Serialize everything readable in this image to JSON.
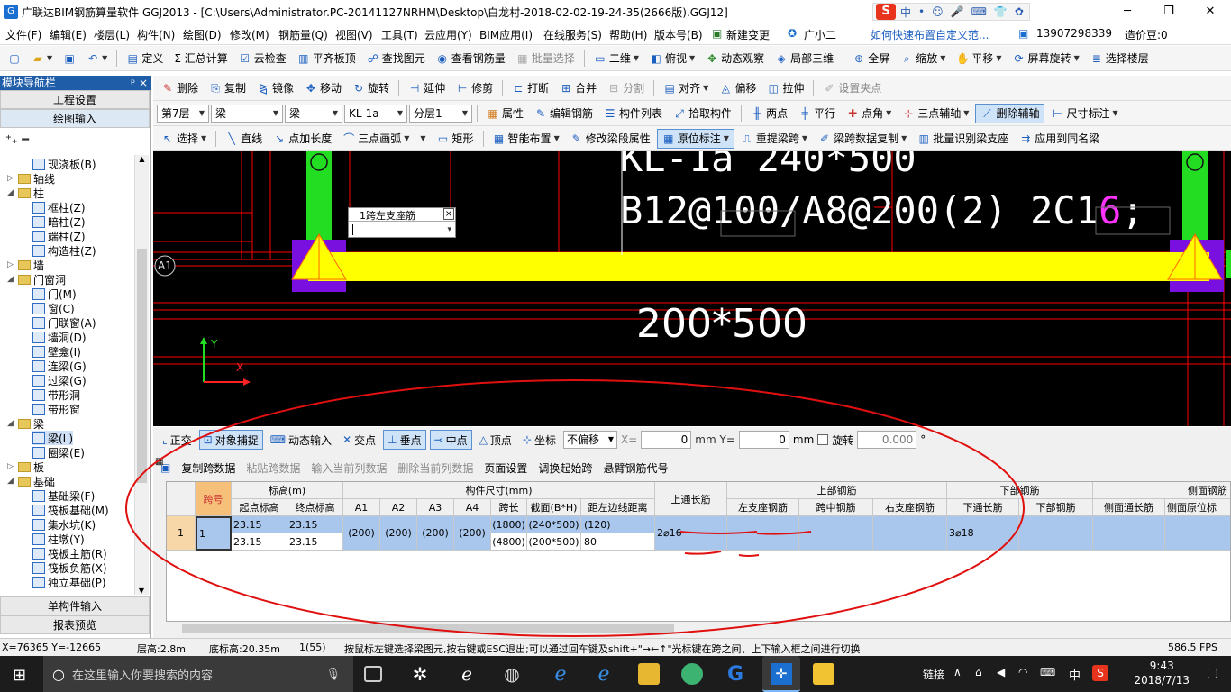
{
  "titlebar": {
    "title": "广联达BIM钢筋算量软件 GGJ2013 - [C:\\Users\\Administrator.PC-20141127NRHM\\Desktop\\白龙村-2018-02-02-19-24-35(2666版).GGJ12]",
    "ime_items": [
      "中",
      "•",
      "☺",
      "🎤",
      "⌨",
      "👕",
      "✿"
    ]
  },
  "menubar": {
    "items": [
      "文件(F)",
      "编辑(E)",
      "楼层(L)",
      "构件(N)",
      "绘图(D)",
      "修改(M)",
      "钢筋量(Q)",
      "视图(V)",
      "工具(T)",
      "云应用(Y)",
      "BIM应用(I)",
      "在线服务(S)",
      "帮助(H)",
      "版本号(B)",
      "新建变更",
      "广小二"
    ],
    "help_link": "如何快速布置自定义范...",
    "phone": "13907298339",
    "price": "造价豆:0"
  },
  "toolbar1": [
    "定义",
    "Σ 汇总计算",
    "云检查",
    "平齐板顶",
    "查找图元",
    "查看钢筋量",
    "批量选择",
    "二维",
    "俯视",
    "动态观察",
    "局部三维",
    "全屏",
    "缩放",
    "平移",
    "屏幕旋转",
    "选择楼层"
  ],
  "toolbar2": [
    "删除",
    "复制",
    "镜像",
    "移动",
    "旋转",
    "延伸",
    "修剪",
    "打断",
    "合并",
    "分割",
    "对齐",
    "偏移",
    "拉伸",
    "设置夹点"
  ],
  "toolbar3": {
    "floor": "第7层",
    "cat1": "梁",
    "cat2": "梁",
    "member": "KL-1a",
    "layer": "分层1",
    "buttons": [
      "属性",
      "编辑钢筋",
      "构件列表",
      "拾取构件",
      "两点",
      "平行",
      "点角",
      "三点辅轴",
      "删除辅轴",
      "尺寸标注"
    ]
  },
  "toolbar4": [
    "选择",
    "直线",
    "点加长度",
    "三点画弧",
    "矩形",
    "智能布置",
    "修改梁段属性",
    "原位标注",
    "重提梁跨",
    "梁跨数据复制",
    "批量识别梁支座",
    "应用到同名梁"
  ],
  "leftpanel": {
    "header": "模块导航栏",
    "pin": "ᵖ ×",
    "btn_project": "工程设置",
    "btn_draw": "绘图输入",
    "btn_single": "单构件输入",
    "btn_report": "报表预览",
    "tree": [
      {
        "label": "现浇板(B)",
        "level": 2
      },
      {
        "label": "轴线",
        "level": 0,
        "folder": true,
        "toggle": "+"
      },
      {
        "label": "柱",
        "level": 0,
        "folder": true,
        "toggle": "−"
      },
      {
        "label": "框柱(Z)",
        "level": 2
      },
      {
        "label": "暗柱(Z)",
        "level": 2
      },
      {
        "label": "端柱(Z)",
        "level": 2
      },
      {
        "label": "构造柱(Z)",
        "level": 2
      },
      {
        "label": "墙",
        "level": 0,
        "folder": true,
        "toggle": "+"
      },
      {
        "label": "门窗洞",
        "level": 0,
        "folder": true,
        "toggle": "−"
      },
      {
        "label": "门(M)",
        "level": 2
      },
      {
        "label": "窗(C)",
        "level": 2
      },
      {
        "label": "门联窗(A)",
        "level": 2
      },
      {
        "label": "墙洞(D)",
        "level": 2
      },
      {
        "label": "壁龛(I)",
        "level": 2
      },
      {
        "label": "连梁(G)",
        "level": 2
      },
      {
        "label": "过梁(G)",
        "level": 2
      },
      {
        "label": "带形洞",
        "level": 2
      },
      {
        "label": "带形窗",
        "level": 2
      },
      {
        "label": "梁",
        "level": 0,
        "folder": true,
        "toggle": "−"
      },
      {
        "label": "梁(L)",
        "level": 2,
        "selected": true
      },
      {
        "label": "圈梁(E)",
        "level": 2
      },
      {
        "label": "板",
        "level": 0,
        "folder": true,
        "toggle": "+"
      },
      {
        "label": "基础",
        "level": 0,
        "folder": true,
        "toggle": "−"
      },
      {
        "label": "基础梁(F)",
        "level": 2
      },
      {
        "label": "筏板基础(M)",
        "level": 2
      },
      {
        "label": "集水坑(K)",
        "level": 2
      },
      {
        "label": "柱墩(Y)",
        "level": 2
      },
      {
        "label": "筏板主筋(R)",
        "level": 2
      },
      {
        "label": "筏板负筋(X)",
        "level": 2
      },
      {
        "label": "独立基础(P)",
        "level": 2
      }
    ]
  },
  "canvas": {
    "annot_line1": "KL-1a 240*500",
    "annot_line2_a": "B12@100/A8@200(2) 2C1",
    "annot_line2_b": "6",
    "annot_line2_c": ";",
    "section_label": "200*500",
    "axis_label": "A1",
    "axis_y": "Y",
    "axis_x": "X",
    "popup_title": "1跨左支座筋",
    "popup_close": "×"
  },
  "snapbar": {
    "items": [
      "正交",
      "对象捕捉",
      "动态输入",
      "交点",
      "垂点",
      "中点",
      "顶点",
      "坐标"
    ],
    "offset": "不偏移",
    "x_label": "X=",
    "x_value": "0",
    "y_label": "mm Y=",
    "y_value": "0",
    "mm": "mm",
    "rotate": "旋转",
    "rotate_value": "0.000",
    "deg": "°"
  },
  "gridtoolbar": {
    "items": [
      "复制跨数据",
      "粘贴跨数据",
      "输入当前列数据",
      "删除当前列数据",
      "页面设置",
      "调换起始跨",
      "悬臂钢筋代号"
    ]
  },
  "grid": {
    "group_headers": [
      "跨号",
      "标高(m)",
      "构件尺寸(mm)",
      "上通长筋",
      "上部钢筋",
      "下部钢筋",
      "侧面钢筋"
    ],
    "sub_headers": [
      "起点标高",
      "终点标高",
      "A1",
      "A2",
      "A3",
      "A4",
      "跨长",
      "截面(B*H)",
      "距左边线距离",
      "左支座钢筋",
      "跨中钢筋",
      "右支座钢筋",
      "下通长筋",
      "下部钢筋",
      "侧面通长筋",
      "侧面原位标"
    ],
    "row": {
      "num": "1",
      "span": "1",
      "start_el_1": "23.15",
      "end_el_1": "23.15",
      "start_el_2": "23.15",
      "end_el_2": "23.15",
      "a1": "(200)",
      "a2": "(200)",
      "a3": "(200)",
      "a4": "(200)",
      "len1": "(1800)",
      "len2": "(4800)",
      "sec1": "(240*500)",
      "sec2": "(200*500)",
      "dist1": "(120)",
      "dist2": "80",
      "top_cont": "2⌀16",
      "bot_cont": "3⌀18"
    }
  },
  "statusbar": {
    "coords": "X=76365 Y=-12665",
    "floor_h": "层高:2.8m",
    "base_el": "底标高:20.35m",
    "count": "1(55)",
    "hint": "按鼠标左键选择梁图元,按右键或ESC退出;可以通过回车键及shift+\"→←↑\"光标键在跨之间、上下输入框之间进行切换",
    "fps": "586.5 FPS"
  },
  "taskbar": {
    "search_placeholder": "在这里输入你要搜索的内容",
    "tray_label": "链接",
    "lang": "中",
    "time": "9:43",
    "date": "2018/7/13"
  },
  "colors": {
    "beam_yellow": "#ffff00",
    "column_green": "#22dd22",
    "support_purple": "#7a10e0",
    "axis_red": "#ff0000",
    "selection_blue": "#a9c7ec",
    "annotation_red": "#e01010"
  }
}
